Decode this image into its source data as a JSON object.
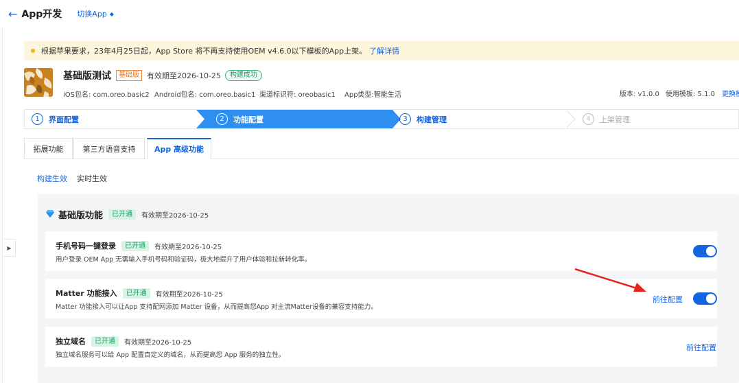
{
  "header": {
    "title": "App开发",
    "switch_label": "切换App"
  },
  "notice": {
    "text": "根据苹果要求，23年4月25日起，App Store 将不再支持使用OEM v4.6.0以下模板的App上架。",
    "link": "了解详情"
  },
  "app": {
    "name": "基础版测试",
    "edition_tag": "基础版",
    "expire": "有效期至2026-10-25",
    "build_status": "构建成功",
    "ios_package": "iOS包名: com.oreo.basic2",
    "android_package": "Android包名: com.oreo.basic1",
    "channel": "渠道标识符: oreobasic1",
    "app_type": "App类型:智能生活",
    "version": "版本: v1.0.0",
    "template": "使用模板: 5.1.0",
    "change_link": "更换模板"
  },
  "steps": [
    {
      "num": "1",
      "label": "界面配置"
    },
    {
      "num": "2",
      "label": "功能配置"
    },
    {
      "num": "3",
      "label": "构建管理"
    },
    {
      "num": "4",
      "label": "上架管理"
    }
  ],
  "tabs": [
    {
      "label": "拓展功能"
    },
    {
      "label": "第三方语音支持"
    },
    {
      "label": "App 高级功能"
    }
  ],
  "subtabs": [
    {
      "label": "构建生效"
    },
    {
      "label": "实时生效"
    }
  ],
  "panel": {
    "title": "基础版功能",
    "status": "已开通",
    "expire": "有效期至2026-10-25"
  },
  "features": [
    {
      "title": "手机号码一键登录",
      "status": "已开通",
      "expire": "有效期至2026-10-25",
      "desc": "用户登录 OEM App 无需输入手机号码和验证码，极大地提升了用户体验和拉新转化率。",
      "enabled": true
    },
    {
      "title": "Matter 功能接入",
      "status": "已开通",
      "expire": "有效期至2026-10-25",
      "desc": "Matter 功能接入可以让App 支持配网添加 Matter 设备，从而提高您App 对主流Matter设备的兼容支持能力。",
      "link": "前往配置",
      "enabled": true
    },
    {
      "title": "独立域名",
      "status": "已开通",
      "expire": "有效期至2026-10-25",
      "desc": "独立域名服务可以给 App 配置自定义的域名，从而提高您 App 服务的独立性。",
      "link": "前往配置"
    }
  ],
  "colors": {
    "accent": "#1565e0",
    "notice_bg": "#fdf6dc",
    "tag_orange": "#e8722a",
    "tag_green": "#18a361",
    "arrow": "#e5261f"
  }
}
